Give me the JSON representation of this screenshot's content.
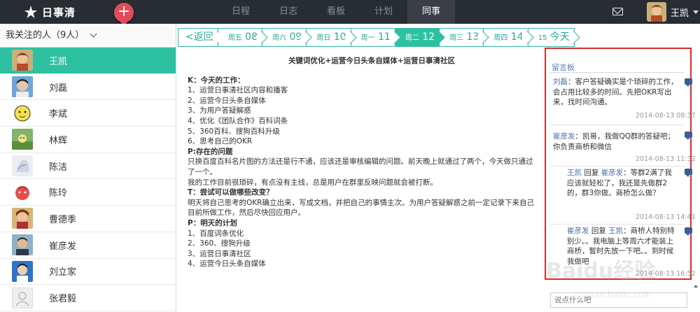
{
  "app": {
    "name": "日事清",
    "add_label": "+"
  },
  "nav": {
    "tabs": [
      "日程",
      "日志",
      "看板",
      "计划",
      "同事"
    ],
    "active": 4
  },
  "user": {
    "name": "王凯"
  },
  "sidebar": {
    "header": "我关注的人（9人）",
    "people": [
      {
        "name": "王凯",
        "active": true
      },
      {
        "name": "刘磊"
      },
      {
        "name": "李斌"
      },
      {
        "name": "林辉"
      },
      {
        "name": "陈洁"
      },
      {
        "name": "陈玲"
      },
      {
        "name": "曹德季"
      },
      {
        "name": "崔彦发"
      },
      {
        "name": "刘立家"
      },
      {
        "name": "张君毅"
      }
    ]
  },
  "datebar": {
    "back": "<返回",
    "days": [
      {
        "wd": "周五",
        "d": "08"
      },
      {
        "wd": "周六",
        "d": "09"
      },
      {
        "wd": "周日",
        "d": "10"
      },
      {
        "wd": "周一",
        "d": "11"
      },
      {
        "wd": "周二",
        "d": "12",
        "active": true
      },
      {
        "wd": "周三",
        "d": "13"
      },
      {
        "wd": "周四",
        "d": "14"
      },
      {
        "wd": "15",
        "d": "今天"
      }
    ]
  },
  "report": {
    "title": "关键词优化+运营今日头条自媒体+运营日事清社区",
    "lines": [
      {
        "t": "K：今天的工作：",
        "b": true
      },
      {
        "t": "1、运营日事清社区内容和播客"
      },
      {
        "t": "2、运营今日头条自媒体"
      },
      {
        "t": "3、为用户答疑解惑"
      },
      {
        "t": "4、优化《团队合作》百科词条"
      },
      {
        "t": "5、360百科、搜狗百科升级"
      },
      {
        "t": "6、思考自己的OKR"
      },
      {
        "t": "P:存在的问题",
        "b": true
      },
      {
        "t": "只换百度百科名片图的方法还是行不通，应该还是审核编辑的问题。前天晚上就通过了两个，今天做只通过了一个。"
      },
      {
        "t": "我的工作目前很琐碎，有点没有主线，总是用户在群里反映问题就会被打断。"
      },
      {
        "t": "T：尝试可以做哪些改变？",
        "b": true
      },
      {
        "t": "明天将自己思考的OKR确立出来，写成文档，并把自己的事情主次。为用户答疑解惑之前一定记录下来自己目前所做工作，然后尽快回应用户。"
      },
      {
        "t": "P：明天的计划",
        "b": true
      },
      {
        "t": "1、百度词条优化"
      },
      {
        "t": "2、360、搜狗升级"
      },
      {
        "t": "3、运营日事清社区"
      },
      {
        "t": "4、运营今日头条自媒体"
      }
    ]
  },
  "board": {
    "title": "留言板",
    "comments": [
      {
        "who": "刘磊",
        "text": "：客户答疑确实是个琐碎的工作，会占用比较多的时间。先把OKR写出来，找时间沟通。",
        "time": "2014-08-13 08:37"
      },
      {
        "who": "崔彦发",
        "text": "：凯哥，我做QQ群的答疑吧；你负责商桥和微信",
        "time": "2014-08-13 11:32"
      },
      {
        "who": "王凯",
        "reply": "回复",
        "to": "崔彦发",
        "text": "：等群2满了我应该就轻松了，我还是先做群2的，群3你做。商桥怎么做？",
        "time": "2014-08-13 14:41"
      },
      {
        "who": "崔彦发",
        "reply": "回复",
        "to": "王凯",
        "text": "：商桥人特别特别少。。我电脑上等周六才能装上商桥，暂时先放一下吧。。到时候我做吧",
        "time": "2014-08-13 16:52"
      }
    ],
    "input_placeholder": "说点什么吧"
  },
  "watermark": {
    "text": "Baidu经验",
    "sub": "jingyan.baidu.com"
  }
}
